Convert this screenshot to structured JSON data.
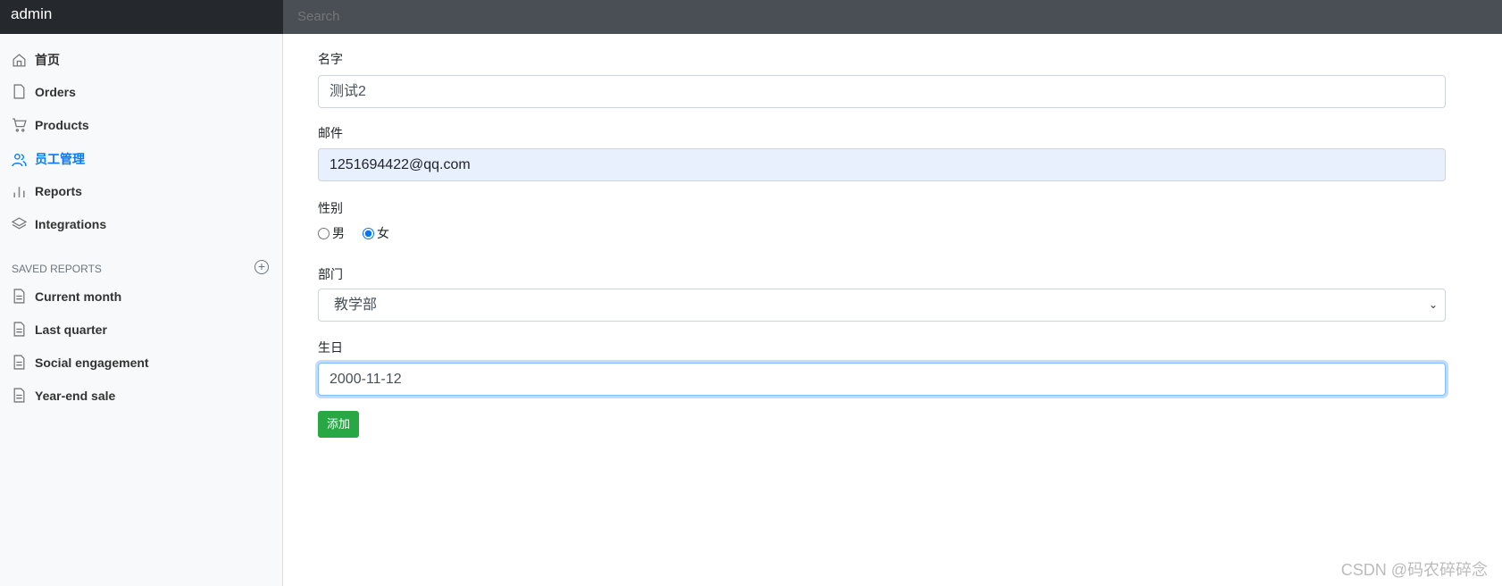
{
  "topbar": {
    "brand": "admin",
    "search_placeholder": "Search"
  },
  "sidebar": {
    "items": [
      {
        "label": "首页",
        "icon": "home-icon"
      },
      {
        "label": "Orders",
        "icon": "file-icon"
      },
      {
        "label": "Products",
        "icon": "cart-icon"
      },
      {
        "label": "员工管理",
        "icon": "users-icon",
        "active": true
      },
      {
        "label": "Reports",
        "icon": "bar-chart-icon"
      },
      {
        "label": "Integrations",
        "icon": "layers-icon"
      }
    ],
    "saved_heading": "Saved reports",
    "saved": [
      {
        "label": "Current month"
      },
      {
        "label": "Last quarter"
      },
      {
        "label": "Social engagement"
      },
      {
        "label": "Year-end sale"
      }
    ]
  },
  "form": {
    "name_label": "名字",
    "name_value": "测试2",
    "email_label": "邮件",
    "email_value": "1251694422@qq.com",
    "gender_label": "性别",
    "gender_options": [
      "男",
      "女"
    ],
    "gender_selected": "女",
    "dept_label": "部门",
    "dept_value": "教学部",
    "birthday_label": "生日",
    "birthday_value": "2000-11-12",
    "submit": "添加"
  },
  "watermark": "CSDN @码农碎碎念",
  "colors": {
    "accent": "#007bff",
    "submit": "#28a745"
  }
}
